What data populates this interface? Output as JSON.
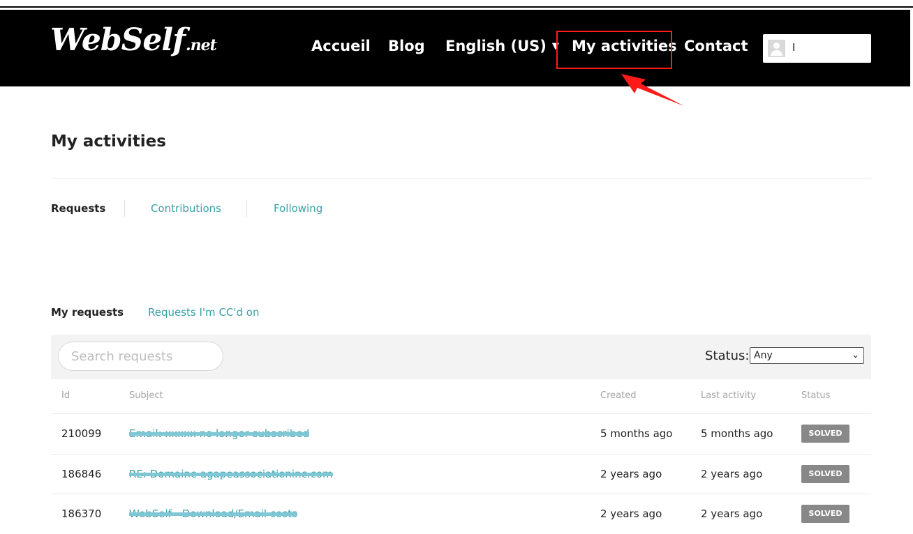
{
  "header": {
    "logo_main": "WebSelf",
    "logo_tld": ".net",
    "nav": {
      "accueil": "Accueil",
      "blog": "Blog",
      "language": "English (US)",
      "activities": "My activities",
      "contact": "Contact"
    },
    "user": {
      "name": "I"
    }
  },
  "annotation": {
    "color": "#ff1a1a"
  },
  "page": {
    "title": "My activities",
    "tabs": [
      "Requests",
      "Contributions",
      "Following"
    ],
    "subtabs": [
      "My requests",
      "Requests I'm CC'd on"
    ]
  },
  "filters": {
    "search_placeholder": "Search requests",
    "status_label": "Status:",
    "status_value": "Any"
  },
  "table": {
    "headers": [
      "Id",
      "Subject",
      "Created",
      "Last activity",
      "Status"
    ],
    "rows": [
      {
        "id": "210099",
        "subject": "Email: xxxxx no longer subscribed",
        "created": "5 months ago",
        "last_activity": "5 months ago",
        "status": "SOLVED"
      },
      {
        "id": "186846",
        "subject": "RE: Domaine agapeassociationinc.com",
        "created": "2 years ago",
        "last_activity": "2 years ago",
        "status": "SOLVED"
      },
      {
        "id": "186370",
        "subject": "WebSelf - Download/Email costs",
        "created": "2 years ago",
        "last_activity": "2 years ago",
        "status": "SOLVED"
      }
    ]
  },
  "colors": {
    "header_bg": "#000000",
    "link": "#3a9fa8",
    "badge": "#888888",
    "redaction": "#7fc7d4"
  }
}
